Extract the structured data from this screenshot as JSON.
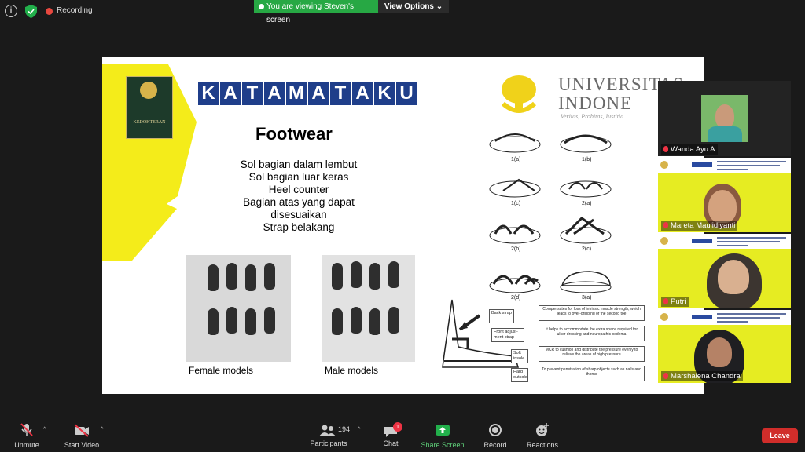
{
  "topbar": {
    "recording_label": "Recording",
    "viewing_text": "You are viewing Steven's screen",
    "view_options": "View Options"
  },
  "slide": {
    "header_letters": [
      "K",
      "A",
      "T",
      "A",
      "M",
      "A",
      "T",
      "A",
      "K",
      "U"
    ],
    "faculty_logo": "KEDOKTERAN",
    "title": "Footwear",
    "bullets": [
      "Sol bagian dalam lembut",
      "Sol bagian luar keras",
      "Heel counter",
      "Bagian atas yang dapat",
      "disesuaikan",
      "Strap belakang"
    ],
    "university_name_line1": "UNIVERSITAS",
    "university_name_line2": "INDONE",
    "university_motto": "Veritas, Probitas, Iustitia",
    "female_caption": "Female models",
    "male_caption": "Male models",
    "figure_labels": [
      "1(a)",
      "1(b)",
      "1(c)",
      "2(a)",
      "2(b)",
      "2(c)",
      "2(d)",
      "3(a)"
    ],
    "parts": [
      {
        "label": "Back strap",
        "desc": "Compensates for loss of intrinsic muscle strength, which leads to over-gripping of the second toe"
      },
      {
        "label": "Front adjust-ment strap",
        "desc": "It helps to accommodate the extra space required for ulcer dressing and neuropathic oedema"
      },
      {
        "label": "Soft insole",
        "desc": "MCR to cushion and distribute the pressure evenly to relieve the areas of high pressure"
      },
      {
        "label": "Hard outsole",
        "desc": "To prevent penetration of sharp objects such as nails and thorns"
      }
    ]
  },
  "participants": [
    {
      "name": "Wanda Ayu A"
    },
    {
      "name": "Mareta Maulidiyanti"
    },
    {
      "name": "Putri"
    },
    {
      "name": "Marshalena Chandra"
    }
  ],
  "toolbar": {
    "unmute": "Unmute",
    "start_video": "Start Video",
    "participants_label": "Participants",
    "participants_count": "194",
    "chat": "Chat",
    "chat_badge": "1",
    "share_screen": "Share Screen",
    "record": "Record",
    "reactions": "Reactions",
    "leave": "Leave"
  },
  "colors": {
    "viewing_green": "#27a844",
    "leave_red": "#d02d2a",
    "slide_yellow": "#f4ec1a",
    "kata_blue": "#1f3e8a"
  }
}
